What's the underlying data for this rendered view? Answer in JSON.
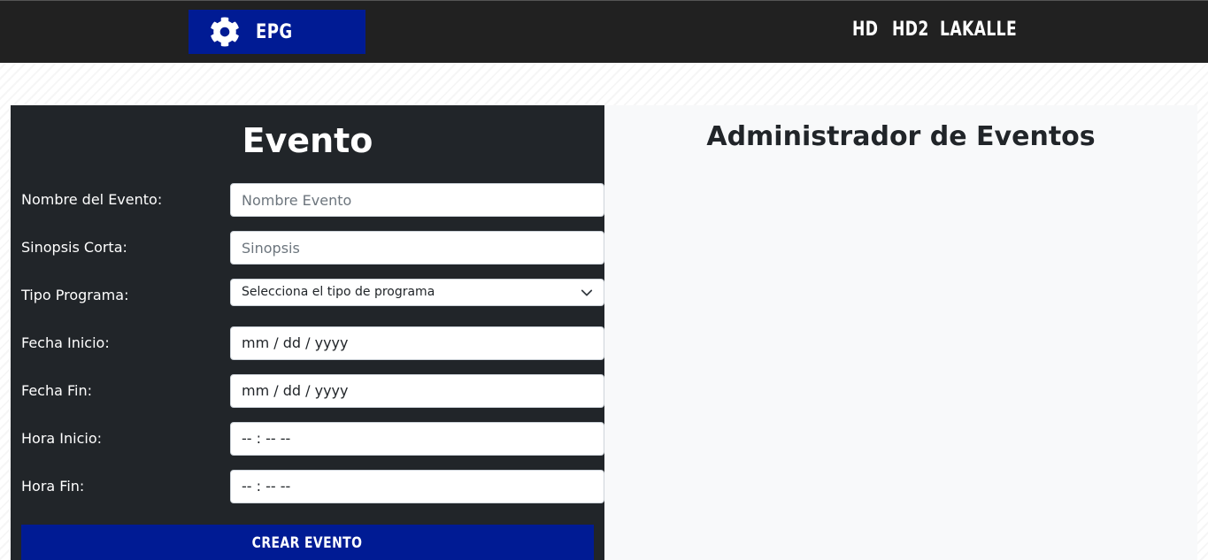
{
  "header": {
    "brand": "EPG",
    "brand_icon": "gear-icon",
    "brand_color": "#001b94",
    "nav": [
      "HD",
      "HD2",
      "LAKALLE"
    ]
  },
  "form": {
    "title": "Evento",
    "fields": {
      "nombre": {
        "label": "Nombre del Evento:",
        "placeholder": "Nombre Evento"
      },
      "sinopsis": {
        "label": "Sinopsis Corta:",
        "placeholder": "Sinopsis"
      },
      "tipo": {
        "label": "Tipo Programa:",
        "selected": "Selecciona el tipo de programa"
      },
      "fecha_inicio": {
        "label": "Fecha Inicio:",
        "value": "mm / dd / yyyy"
      },
      "fecha_fin": {
        "label": "Fecha Fin:",
        "value": "mm / dd / yyyy"
      },
      "hora_inicio": {
        "label": "Hora Inicio:",
        "value": "-- : --  --"
      },
      "hora_fin": {
        "label": "Hora Fin:",
        "value": "-- : --  --"
      }
    },
    "submit_label": "CREAR EVENTO"
  },
  "admin": {
    "title": "Administrador de Eventos"
  }
}
